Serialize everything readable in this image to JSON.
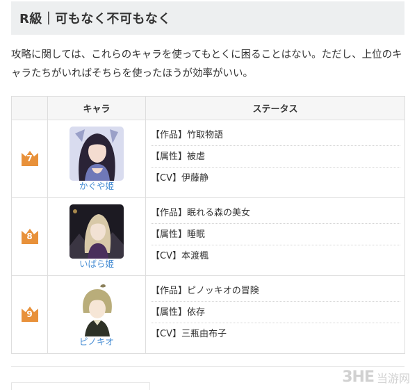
{
  "section": {
    "title": "R級｜可もなく不可もなく"
  },
  "intro": "攻略に関しては、これらのキャラを使ってもとくに困ることはない。ただし、上位のキャラたちがいればそちらを使ったほうが効率がいい。",
  "table": {
    "headers": {
      "rank": "",
      "chara": "キャラ",
      "status": "ステータス"
    },
    "rows": [
      {
        "rank": "7",
        "name": "かぐや姫",
        "stats": [
          "【作品】竹取物語",
          "【属性】被虐",
          "【CV】伊藤静"
        ]
      },
      {
        "rank": "8",
        "name": "いばら姫",
        "stats": [
          "【作品】眠れる森の美女",
          "【属性】睡眠",
          "【CV】本渡楓"
        ]
      },
      {
        "rank": "9",
        "name": "ピノキオ",
        "stats": [
          "【作品】ピノッキオの冒険",
          "【属性】依存",
          "【CV】三瓶由布子"
        ]
      }
    ]
  },
  "watermark": {
    "logo": "3HE",
    "text": "当游网"
  },
  "colors": {
    "crown": "#e8913a",
    "name_link": "#4a8fd4",
    "heading_bg": "#edeff0"
  }
}
